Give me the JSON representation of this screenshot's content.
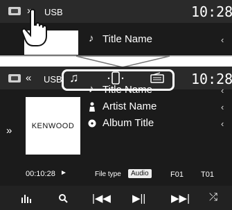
{
  "top": {
    "source": "USB",
    "time": "10:28",
    "title_name": "Title Name"
  },
  "bottom": {
    "source": "USB",
    "time": "10:28",
    "title_name": "Title Name",
    "artist_name": "Artist Name",
    "album_title": "Album Title",
    "album_art_text": "KENWOOD",
    "elapsed": "00:10:28",
    "file_type_label": "File type",
    "file_type_value": "Audio",
    "folder": "F01",
    "track": "T01"
  }
}
